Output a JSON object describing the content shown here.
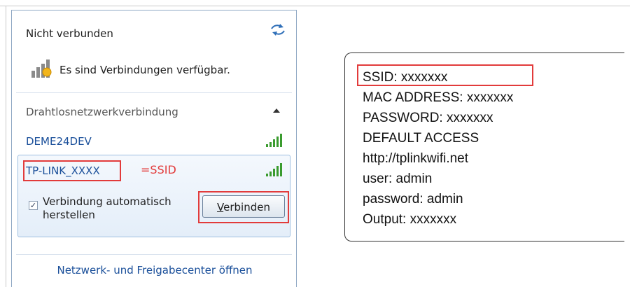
{
  "flyout": {
    "status_title": "Nicht verbunden",
    "available_text": "Es sind Verbindungen verfügbar.",
    "section_header": "Drahtlosnetzwerkverbindung",
    "networks": [
      {
        "name": "DEME24DEV",
        "signal_icon": "signal-bars-icon"
      },
      {
        "name": "TP-LINK_XXXX",
        "signal_icon": "signal-bars-icon"
      }
    ],
    "ssid_annotation": "=SSID",
    "auto_connect_label": "Verbindung automatisch herstellen",
    "auto_connect_checked": true,
    "connect_button": {
      "accel": "V",
      "rest": "erbinden"
    },
    "footer_link": "Netzwerk- und Freigabecenter öffnen"
  },
  "info_card": {
    "lines": [
      "SSID: xxxxxxx",
      "MAC ADDRESS: xxxxxxx",
      "PASSWORD: xxxxxxx",
      "DEFAULT ACCESS",
      "http://tplinkwifi.net",
      "user: admin",
      "password: admin",
      "Output: xxxxxxx"
    ]
  },
  "colors": {
    "highlight": "#e23b3b",
    "link_blue": "#1a4f9a",
    "signal_green": "#3a9b2e"
  }
}
